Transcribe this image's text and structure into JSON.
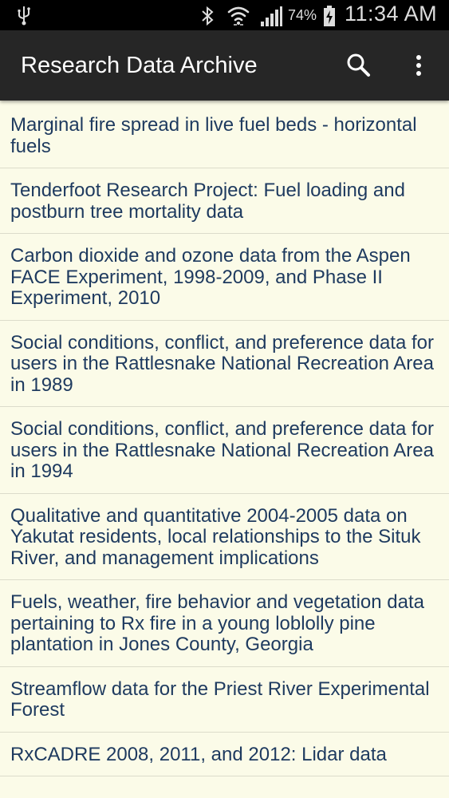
{
  "status_bar": {
    "battery_percent": "74%",
    "time": "11:34 AM",
    "icons": [
      "usb-icon",
      "bluetooth-icon",
      "wifi-icon",
      "signal-icon",
      "battery-charging-icon"
    ]
  },
  "action_bar": {
    "title": "Research Data Archive",
    "actions": [
      "search-icon",
      "overflow-menu-icon"
    ]
  },
  "colors": {
    "list_background": "#fbfbe8",
    "item_text": "#1e3a5f",
    "action_bar": "#262626",
    "status_bar": "#000000"
  },
  "list": {
    "items": [
      "Marginal fire spread in live fuel beds - horizontal fuels",
      "Tenderfoot Research Project: Fuel loading and postburn tree mortality data",
      "Carbon dioxide and ozone data from the Aspen FACE Experiment, 1998-2009, and Phase II Experiment, 2010",
      "Social conditions, conflict, and preference data for users in the Rattlesnake National Recreation Area in 1989",
      "Social conditions, conflict, and preference data for users in the Rattlesnake National Recreation Area in 1994",
      "Qualitative and quantitative 2004-2005 data on Yakutat residents, local relationships to the Situk River, and management implications",
      "Fuels, weather, fire behavior and vegetation data pertaining to Rx fire in a young loblolly pine plantation in Jones County, Georgia",
      "Streamflow data for the Priest River Experimental Forest",
      "RxCADRE 2008, 2011, and 2012: Lidar data"
    ]
  }
}
